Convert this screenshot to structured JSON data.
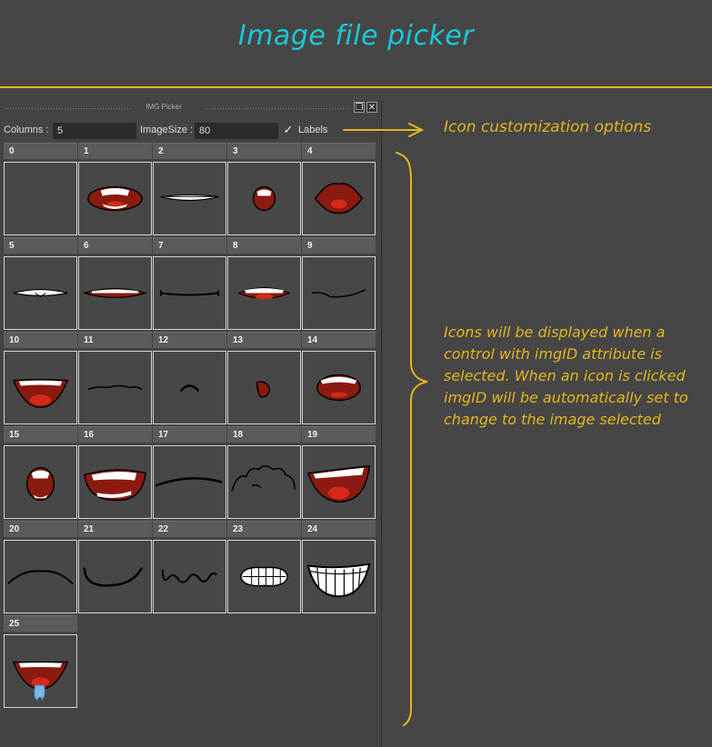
{
  "page_title": "Image file picker",
  "panel": {
    "title": "IMG Picker",
    "restore_icon": "restore-icon",
    "close_icon": "close-icon",
    "columns_label": "Columns :",
    "columns_value": "5",
    "image_size_label": "ImageSize :",
    "image_size_value": "80",
    "labels_checked": true,
    "labels_label": "Labels"
  },
  "cells": [
    {
      "label": "0",
      "icon": "blank"
    },
    {
      "label": "1",
      "icon": "open-mouth-teeth"
    },
    {
      "label": "2",
      "icon": "thin-teeth-smile"
    },
    {
      "label": "3",
      "icon": "small-open-mouth"
    },
    {
      "label": "4",
      "icon": "pucker-lips"
    },
    {
      "label": "5",
      "icon": "flat-teeth"
    },
    {
      "label": "6",
      "icon": "flat-open-red"
    },
    {
      "label": "7",
      "icon": "flat-line"
    },
    {
      "label": "8",
      "icon": "small-open-red"
    },
    {
      "label": "9",
      "icon": "slight-line"
    },
    {
      "label": "10",
      "icon": "smile-tongue"
    },
    {
      "label": "11",
      "icon": "wavy-line"
    },
    {
      "label": "12",
      "icon": "small-frown"
    },
    {
      "label": "13",
      "icon": "tiny-o"
    },
    {
      "label": "14",
      "icon": "open-teeth-oval"
    },
    {
      "label": "15",
      "icon": "tall-open"
    },
    {
      "label": "16",
      "icon": "wide-open-teeth"
    },
    {
      "label": "17",
      "icon": "arc-line"
    },
    {
      "label": "18",
      "icon": "curly-line"
    },
    {
      "label": "19",
      "icon": "big-smile-tongue"
    },
    {
      "label": "20",
      "icon": "frown-line"
    },
    {
      "label": "21",
      "icon": "u-smile"
    },
    {
      "label": "22",
      "icon": "zigzag-line"
    },
    {
      "label": "23",
      "icon": "clenched-teeth"
    },
    {
      "label": "24",
      "icon": "big-grin-teeth"
    },
    {
      "label": "25",
      "icon": "smile-drool"
    }
  ],
  "annotations": {
    "options_note": "Icon customization options",
    "icons_note": "Icons will be displayed when a control with imgID attribute is selected. When an icon is clicked imgID will be automatically set to change to the image selected"
  },
  "colors": {
    "title": "#19c8d8",
    "accent": "#e3b51c",
    "mouth_red": "#8b1a10",
    "tongue": "#d42a1a"
  }
}
